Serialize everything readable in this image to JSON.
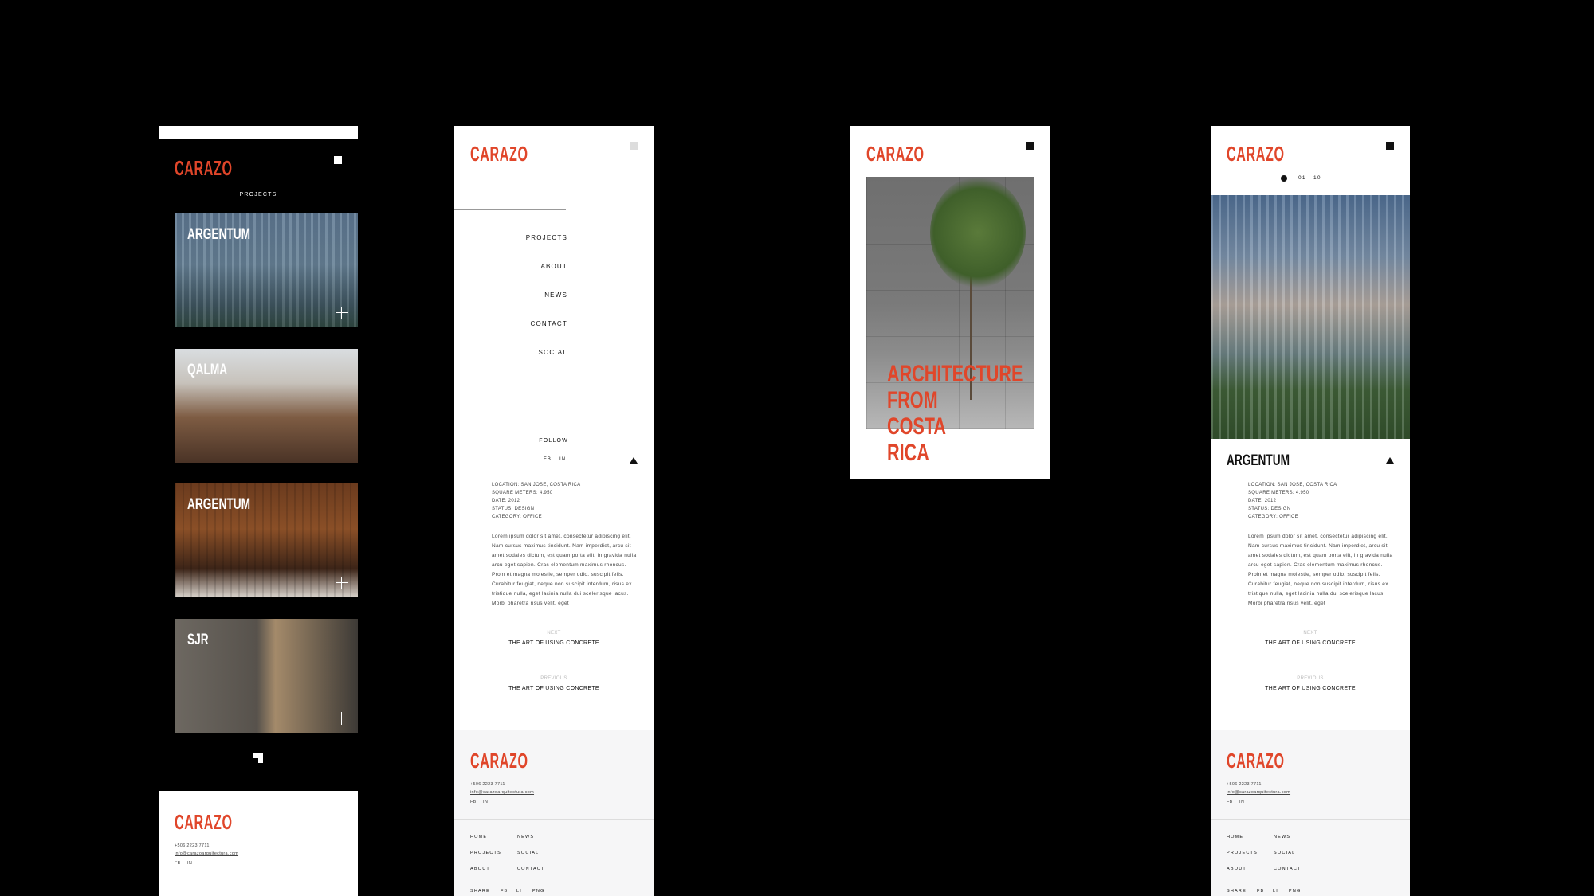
{
  "brand": {
    "logo": "CARAZO",
    "accent": "#e0462a"
  },
  "screen1": {
    "nav_label": "PROJECTS",
    "projects": [
      {
        "title": "ARGENTUM"
      },
      {
        "title": "QALMA"
      },
      {
        "title": "ARGENTUM"
      },
      {
        "title": "SJR"
      }
    ],
    "footer": {
      "phone": "+506 2223 7711",
      "email": "info@carazoarquitectura.com",
      "social": [
        "FB",
        "IN"
      ]
    }
  },
  "screen2": {
    "menu": [
      "PROJECTS",
      "ABOUT",
      "NEWS",
      "CONTACT",
      "SOCIAL"
    ],
    "follow": "FOLLOW",
    "social": [
      "FB",
      "IN"
    ],
    "details": [
      "LOCATION: SAN JOSE, COSTA RICA",
      "SQUARE METERS: 4.950",
      "DATE: 2012",
      "STATUS: DESIGN",
      "CATEGORY: OFFICE"
    ],
    "body": "Lorem ipsum dolor sit amet, consectetur adipiscing elit. Nam cursus maximus tincidunt. Nam imperdiet, arcu sit amet sodales dictum, est quam porta elit, in gravida nulla arcu eget sapien. Cras elementum maximus rhoncus. Proin et magna molestie, semper odio. suscipit felis. Curabitur feugiat, neque non suscipit interdum, risus ex tristique nulla, eget lacinia nulla dui scelerisque lacus. Morbi pharetra risus velit, eget",
    "next_label": "NEXT",
    "next_title": "THE ART OF USING CONCRETE",
    "prev_label": "PREVIOUS",
    "prev_title": "THE ART OF USING CONCRETE",
    "footer": {
      "phone": "+506 2223 7711",
      "email": "info@carazoarquitectura.com",
      "social": [
        "FB",
        "IN"
      ],
      "links_col1": [
        "HOME",
        "PROJECTS",
        "ABOUT"
      ],
      "links_col2": [
        "NEWS",
        "SOCIAL",
        "CONTACT"
      ],
      "share": [
        "SHARE",
        "FB",
        "LI",
        "PNG"
      ]
    }
  },
  "screen3": {
    "headline": [
      "ARCHITECTURE",
      "FROM",
      "COSTA",
      "RICA"
    ]
  },
  "screen4": {
    "pager": "01 - 10",
    "title": "ARGENTUM",
    "details": [
      "LOCATION: SAN JOSE, COSTA RICA",
      "SQUARE METERS: 4.950",
      "DATE: 2012",
      "STATUS: DESIGN",
      "CATEGORY: OFFICE"
    ],
    "body": "Lorem ipsum dolor sit amet, consectetur adipiscing elit. Nam cursus maximus tincidunt. Nam imperdiet, arcu sit amet sodales dictum, est quam porta elit, in gravida nulla arcu eget sapien. Cras elementum maximus rhoncus. Proin et magna molestie, semper odio. suscipit felis. Curabitur feugiat, neque non suscipit interdum, risus ex tristique nulla, eget lacinia nulla dui scelerisque lacus. Morbi pharetra risus velit, eget",
    "next_label": "NEXT",
    "next_title": "THE ART OF USING CONCRETE",
    "prev_label": "PREVIOUS",
    "prev_title": "THE ART OF USING CONCRETE",
    "footer": {
      "phone": "+506 2223 7711",
      "email": "info@carazoarquitectura.com",
      "social": [
        "FB",
        "IN"
      ],
      "links_col1": [
        "HOME",
        "PROJECTS",
        "ABOUT"
      ],
      "links_col2": [
        "NEWS",
        "SOCIAL",
        "CONTACT"
      ],
      "share": [
        "SHARE",
        "FB",
        "LI",
        "PNG"
      ]
    }
  }
}
